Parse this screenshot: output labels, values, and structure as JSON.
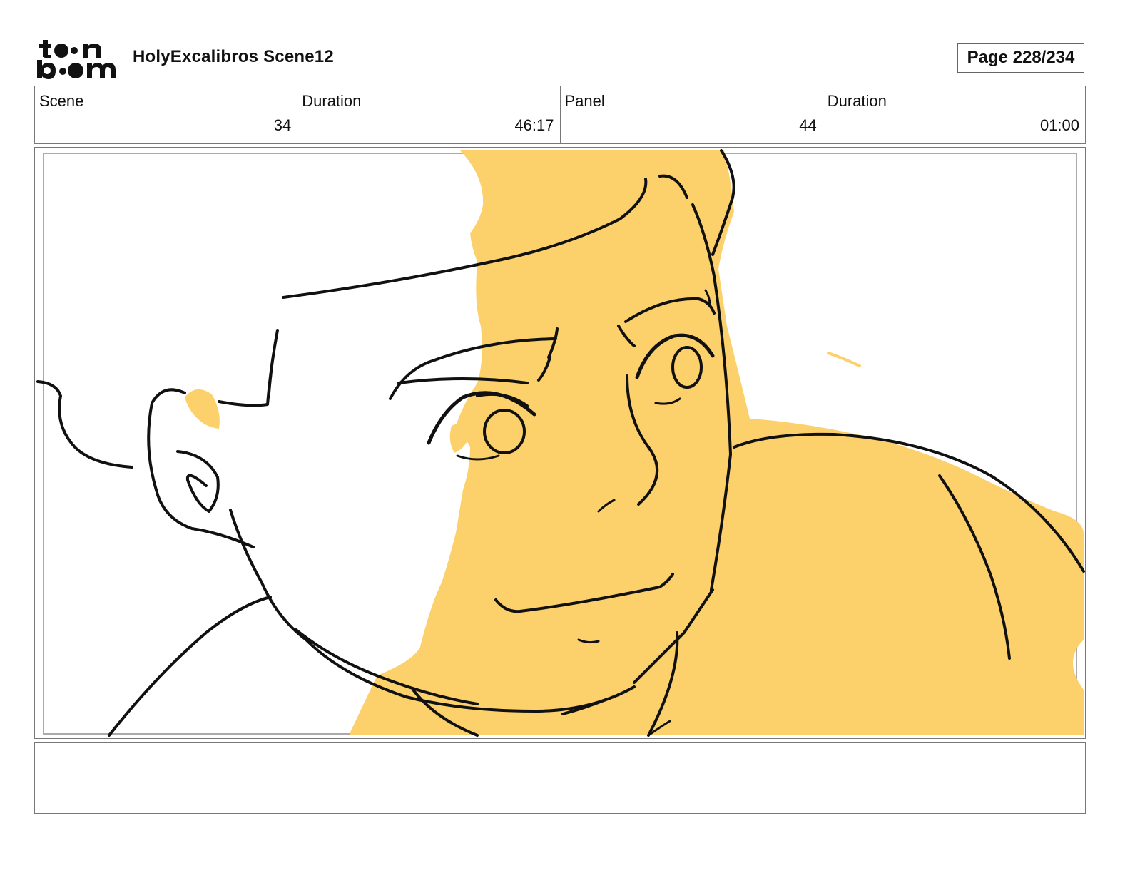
{
  "header": {
    "logo_text": "toon boom",
    "project_title": "HolyExcalibros Scene12",
    "page_label": "Page 228/234"
  },
  "info": {
    "scene_label": "Scene",
    "scene_value": "34",
    "scene_duration_label": "Duration",
    "scene_duration_value": "46:17",
    "panel_label": "Panel",
    "panel_value": "44",
    "panel_duration_label": "Duration",
    "panel_duration_value": "01:00"
  },
  "colors": {
    "fill": "#fcd06b",
    "line": "#111111",
    "border": "#777777"
  },
  "notes": {
    "text": ""
  }
}
